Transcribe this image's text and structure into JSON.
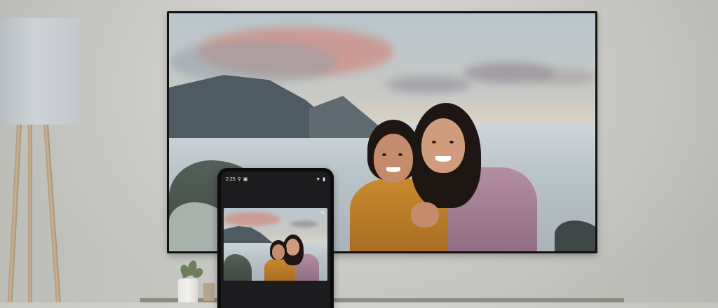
{
  "phone": {
    "status_time": "2:25",
    "status_icons": [
      "location-icon",
      "cast-status-icon",
      "wifi-icon",
      "battery-icon"
    ],
    "cast_icon": "cast-icon"
  },
  "colors": {
    "wall": "#cfcfcb",
    "tv_bezel": "#111111",
    "phone_body": "#0c0c0c",
    "sweater_yellow": "#c98a2e",
    "jacket_pink": "#b48da1"
  }
}
